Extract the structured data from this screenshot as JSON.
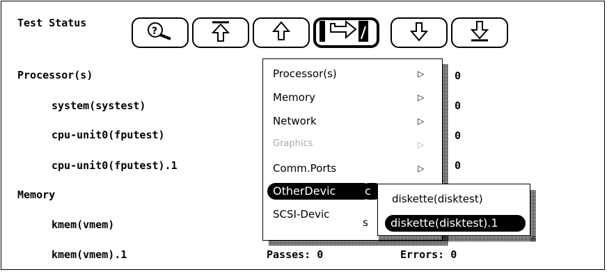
{
  "panel": {
    "title": "Test Status"
  },
  "toolbar": {
    "buttons": [
      {
        "name": "help-search-icon"
      },
      {
        "name": "move-to-top-icon"
      },
      {
        "name": "move-up-icon"
      },
      {
        "name": "submenu-cursor-icon"
      },
      {
        "name": "move-down-icon"
      },
      {
        "name": "move-to-bottom-icon"
      }
    ]
  },
  "rows": [
    {
      "label": "Processor(s)",
      "stat_value": "0"
    },
    {
      "label": "system(systest)",
      "stat_value": "0"
    },
    {
      "label": "cpu-unit0(fputest)",
      "stat_value": "0"
    },
    {
      "label": "cpu-unit0(fputest).1",
      "stat_value": "0"
    },
    {
      "label": "Memory",
      "stat_value": ""
    },
    {
      "label": "kmem(vmem)",
      "stat_value": ""
    },
    {
      "label": "kmem(vmem).1",
      "passes": "Passes: 0",
      "errors": "Errors: 0"
    }
  ],
  "menu": {
    "items": [
      {
        "label": "Processor(s)",
        "arrow": "▷"
      },
      {
        "label": "Memory",
        "arrow": "▷"
      },
      {
        "label": "Network",
        "arrow": "▷"
      },
      {
        "label": "Graphics",
        "arrow": "▷"
      },
      {
        "label": "Comm.Ports",
        "arrow": "▷"
      },
      {
        "label": "OtherDevic"
      },
      {
        "label": "SCSI-Devic"
      }
    ],
    "submenu_fragment_c": "c",
    "submenu_fragment_s": "s"
  },
  "submenu": {
    "items": [
      {
        "label": "diskette(disktest)"
      },
      {
        "label": "diskette(disktest).1"
      }
    ]
  }
}
